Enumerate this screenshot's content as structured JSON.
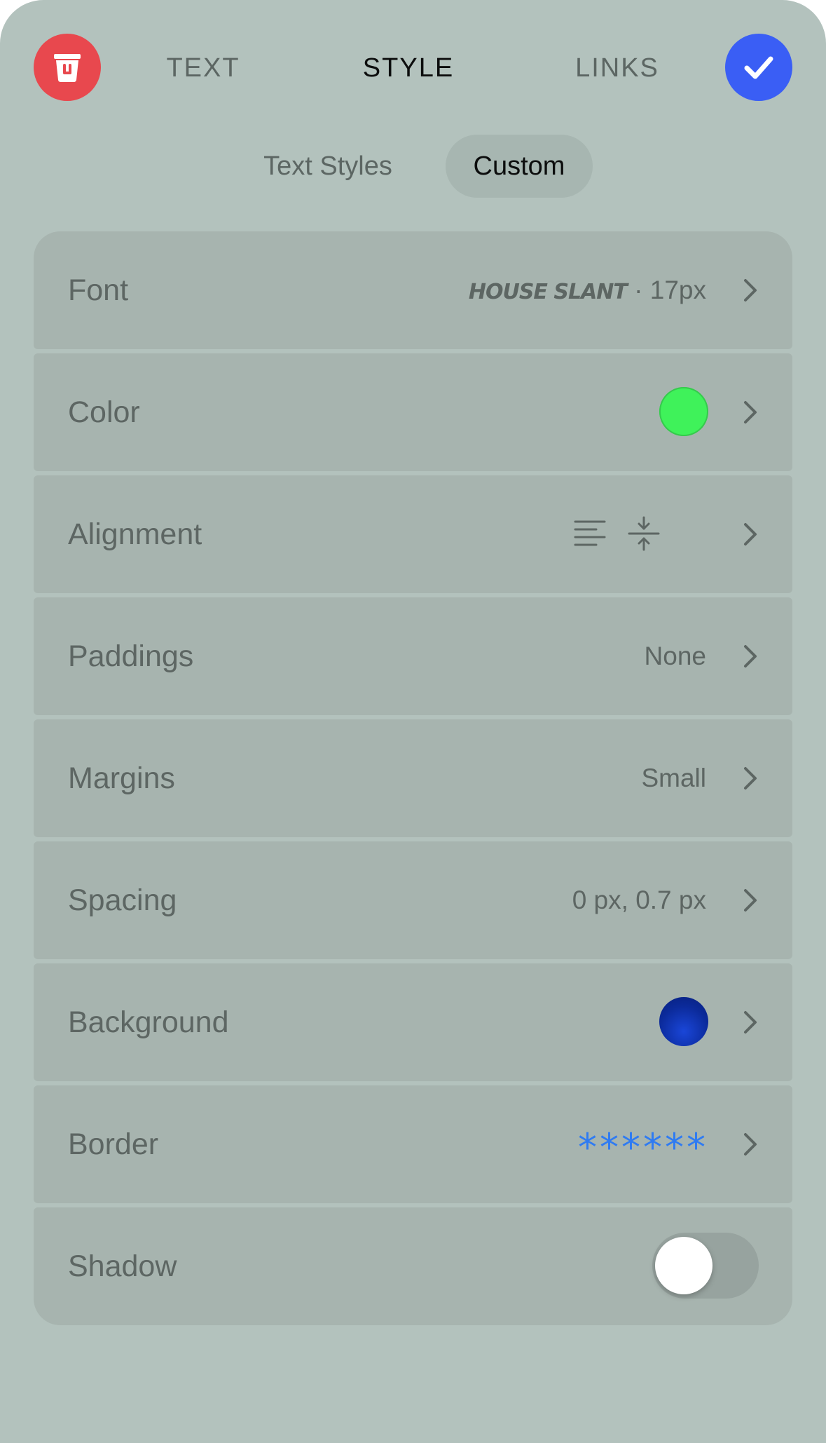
{
  "header": {
    "delete_icon": "trash-icon",
    "confirm_icon": "checkmark-icon",
    "tabs": [
      {
        "label": "TEXT",
        "active": false
      },
      {
        "label": "STYLE",
        "active": true
      },
      {
        "label": "LINKS",
        "active": false
      }
    ]
  },
  "segments": [
    {
      "label": "Text Styles",
      "active": false
    },
    {
      "label": "Custom",
      "active": true
    }
  ],
  "settings": {
    "font": {
      "label": "Font",
      "font_name": "HOUSE SLANT",
      "separator": " · ",
      "size": "17px"
    },
    "color": {
      "label": "Color",
      "swatch": "#3ff25a"
    },
    "alignment": {
      "label": "Alignment",
      "icons": [
        "align-left-icon",
        "vertical-center-icon"
      ]
    },
    "paddings": {
      "label": "Paddings",
      "value": "None"
    },
    "margins": {
      "label": "Margins",
      "value": "Small"
    },
    "spacing": {
      "label": "Spacing",
      "value": "0 px, 0.7 px"
    },
    "background": {
      "label": "Background",
      "swatch": "#0b2a9a"
    },
    "border": {
      "label": "Border",
      "value": "******",
      "color": "#2f7bf2"
    },
    "shadow": {
      "label": "Shadow",
      "enabled": false
    }
  },
  "colors": {
    "panel": "#b3c2bd",
    "row": "#a7b4af",
    "delete": "#e8484e",
    "confirm": "#3a5ef5"
  }
}
